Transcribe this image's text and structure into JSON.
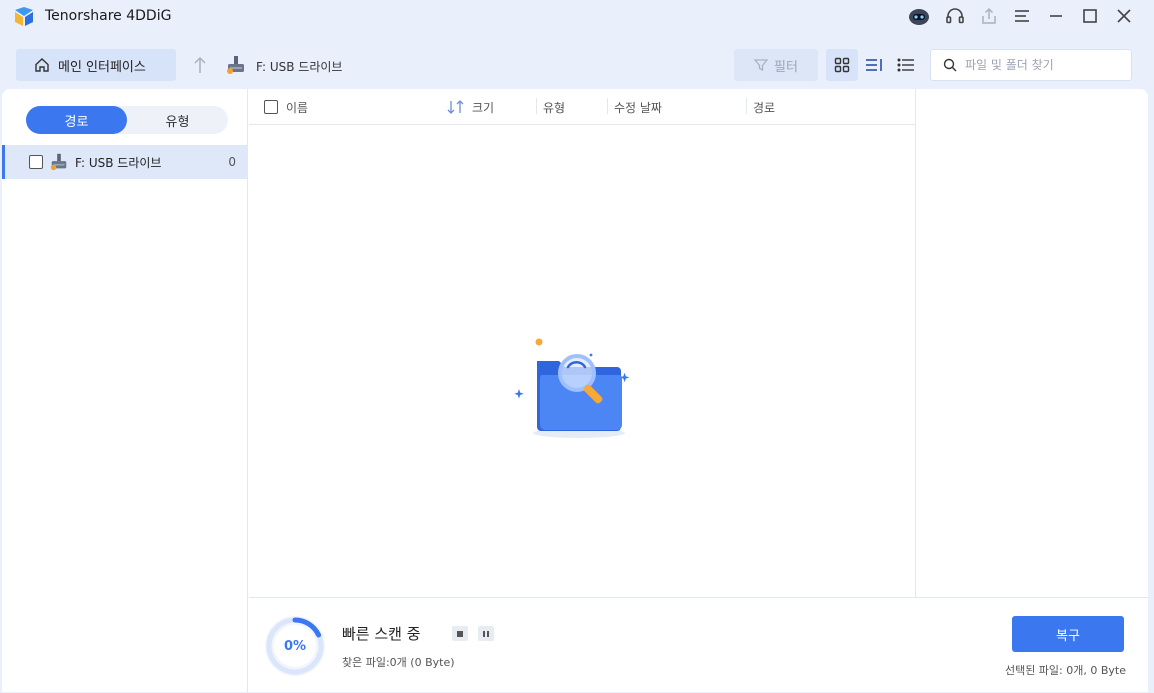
{
  "app": {
    "title": "Tenorshare 4DDiG"
  },
  "window_controls": [
    "robot-assistant-icon",
    "headset-icon",
    "share-icon",
    "menu-icon",
    "minimize-icon",
    "maximize-icon",
    "close-icon"
  ],
  "toolbar": {
    "home_label": "메인 인터페이스",
    "breadcrumb": "F: USB 드라이브",
    "filter_label": "필터",
    "search_placeholder": "파일 및 폴더 찾기",
    "view_modes": [
      "grid-view-icon",
      "detail-view-icon",
      "list-view-icon"
    ],
    "active_view": "grid-view-icon"
  },
  "sidebar": {
    "tabs": [
      "경로",
      "유형"
    ],
    "active_tab": "경로",
    "items": [
      {
        "label": "F: USB 드라이브",
        "count": "0",
        "checked": false
      }
    ]
  },
  "table": {
    "columns": [
      "이름",
      "크기",
      "유형",
      "수정 날짜",
      "경로"
    ],
    "rows": []
  },
  "scan": {
    "progress": "0%",
    "progress_fraction": 0.0,
    "status": "빠른 스캔 중",
    "found": "찾은 파일:0개 (0 Byte)"
  },
  "footer": {
    "recover_label": "복구",
    "selected_info": "선택된 파일: 0개, 0 Byte"
  },
  "colors": {
    "accent": "#3b78f0",
    "background": "#e9effb",
    "selected_row": "#dfe8f9"
  }
}
